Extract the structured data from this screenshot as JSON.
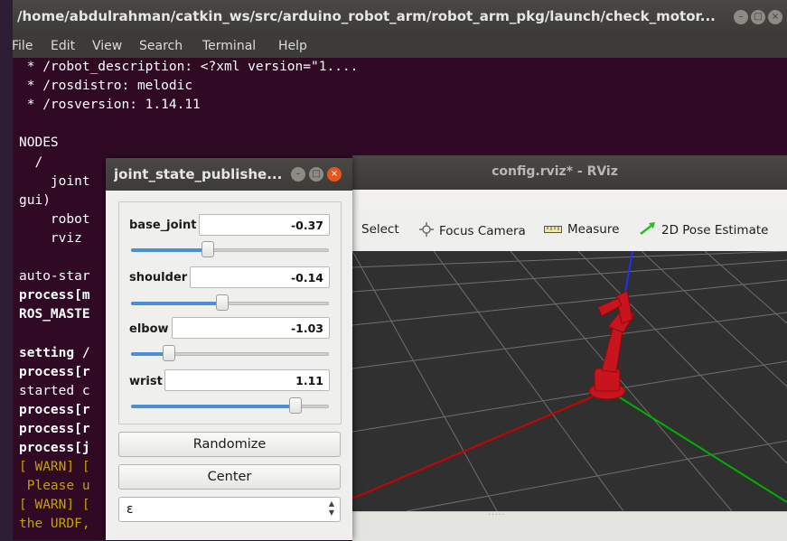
{
  "terminal": {
    "title": "/home/abdulrahman/catkin_ws/src/arduino_robot_arm/robot_arm_pkg/launch/check_motor...",
    "menu": [
      "File",
      "Edit",
      "View",
      "Search",
      "Terminal",
      "Help"
    ],
    "lines": [
      {
        "text": " * /robot_description: <?xml version=\"1....",
        "style": "normal"
      },
      {
        "text": " * /rosdistro: melodic",
        "style": "normal"
      },
      {
        "text": " * /rosversion: 1.14.11",
        "style": "normal"
      },
      {
        "text": "",
        "style": "normal"
      },
      {
        "text": "NODES",
        "style": "normal"
      },
      {
        "text": "  /",
        "style": "normal"
      },
      {
        "text": "    joint",
        "style": "normal"
      },
      {
        "text": "gui)",
        "style": "normal"
      },
      {
        "text": "    robot",
        "style": "normal"
      },
      {
        "text": "    rviz",
        "style": "normal"
      },
      {
        "text": "",
        "style": "normal"
      },
      {
        "text": "auto-star",
        "style": "normal"
      },
      {
        "text": "process[m",
        "style": "bold"
      },
      {
        "text": "ROS_MASTE",
        "style": "bold"
      },
      {
        "text": "",
        "style": "normal"
      },
      {
        "text": "setting /",
        "style": "bold"
      },
      {
        "text": "process[r",
        "style": "bold"
      },
      {
        "text": "started c",
        "style": "normal"
      },
      {
        "text": "process[r",
        "style": "bold"
      },
      {
        "text": "process[r",
        "style": "bold"
      },
      {
        "text": "process[j",
        "style": "bold"
      },
      {
        "text": "[ WARN] [",
        "style": "warn"
      },
      {
        "text": " Please u",
        "style": "warn"
      },
      {
        "text": "[ WARN] [",
        "style": "warn"
      },
      {
        "text": "the URDF,",
        "style": "warn"
      }
    ]
  },
  "rviz": {
    "title": "config.rviz* - RViz",
    "tools": {
      "select": "Select",
      "focus_camera": "Focus Camera",
      "measure": "Measure",
      "pose_estimate": "2D Pose Estimate"
    }
  },
  "jsp": {
    "title": "joint_state_publishe...",
    "joints": [
      {
        "name": "base_joint",
        "value": "-0.37",
        "slider_fraction": 0.39
      },
      {
        "name": "shoulder",
        "value": "-0.14",
        "slider_fraction": 0.46
      },
      {
        "name": "elbow",
        "value": "-1.03",
        "slider_fraction": 0.19
      },
      {
        "name": "wrist",
        "value": "1.11",
        "slider_fraction": 0.83
      }
    ],
    "randomize_label": "Randomize",
    "center_label": "Center",
    "spin_value": "ε"
  },
  "colors": {
    "terminal_bg": "#300a24",
    "warn": "#c4a000",
    "slider_fill": "#4a90d9",
    "close_button": "#e9541e",
    "robot": "#c8141c",
    "axis_x": "#d00000",
    "axis_y": "#00b000",
    "axis_z": "#2030ff"
  }
}
